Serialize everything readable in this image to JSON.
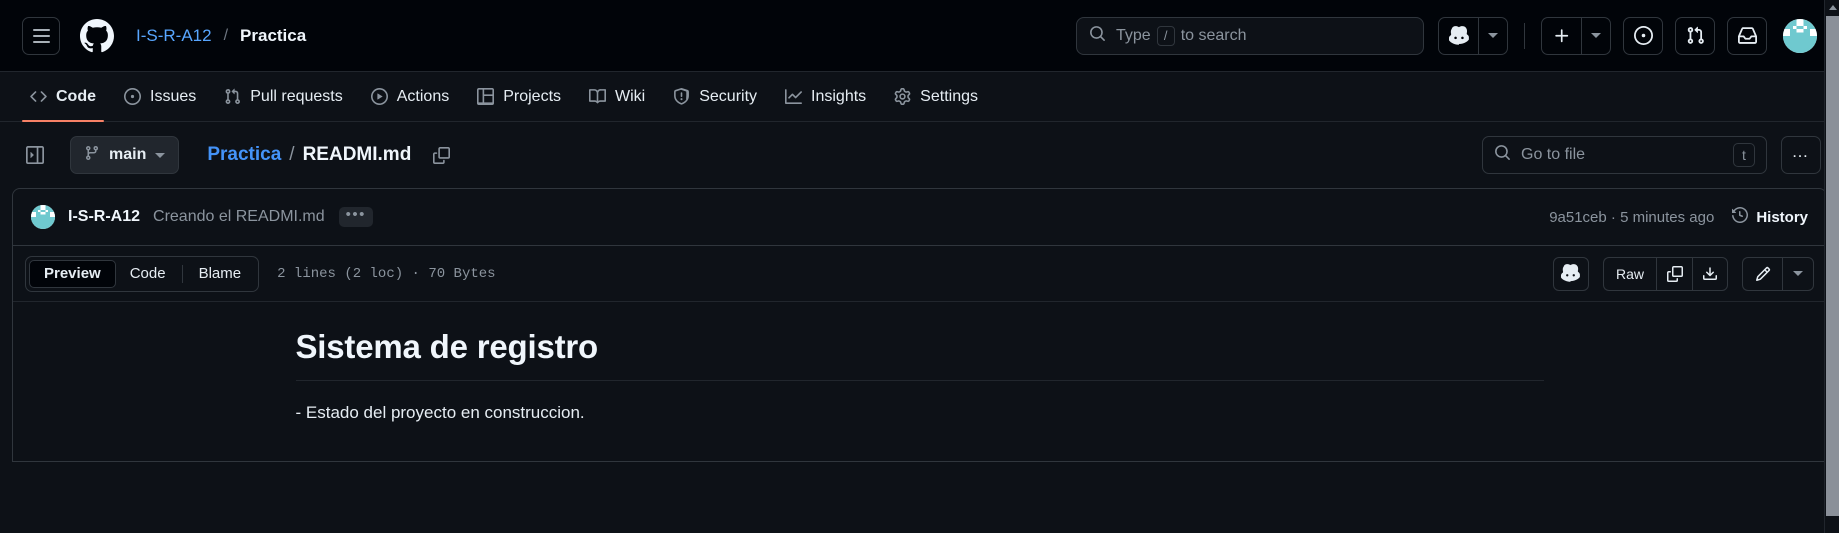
{
  "header": {
    "menu_icon": "hamburger-menu-icon",
    "logo_icon": "github-mark-icon",
    "owner": "I-S-R-A12",
    "separator": "/",
    "repo": "Practica",
    "search": {
      "icon": "search-icon",
      "placeholder_prefix": "Type",
      "key_hint": "/",
      "placeholder_suffix": "to search"
    },
    "actions": [
      {
        "name": "copilot-button",
        "icon": "copilot-icon"
      },
      {
        "name": "copilot-dropdown-button",
        "icon": "chevron-down-icon"
      },
      {
        "name": "create-new-button",
        "icon": "plus-icon"
      },
      {
        "name": "create-new-dropdown-button",
        "icon": "chevron-down-icon"
      },
      {
        "name": "issues-button",
        "icon": "issue-opened-icon"
      },
      {
        "name": "pull-requests-button",
        "icon": "git-pull-request-icon"
      },
      {
        "name": "notifications-button",
        "icon": "inbox-icon"
      },
      {
        "name": "user-avatar",
        "icon": "avatar-icon"
      }
    ]
  },
  "repo_nav": {
    "active": "Code",
    "accent_color": "#f78166",
    "items": [
      {
        "label": "Code",
        "icon": "code-icon"
      },
      {
        "label": "Issues",
        "icon": "issue-opened-icon"
      },
      {
        "label": "Pull requests",
        "icon": "git-pull-request-icon"
      },
      {
        "label": "Actions",
        "icon": "play-icon"
      },
      {
        "label": "Projects",
        "icon": "table-icon"
      },
      {
        "label": "Wiki",
        "icon": "book-icon"
      },
      {
        "label": "Security",
        "icon": "shield-icon"
      },
      {
        "label": "Insights",
        "icon": "graph-icon"
      },
      {
        "label": "Settings",
        "icon": "gear-icon"
      }
    ]
  },
  "file_bar": {
    "sidebar_toggle_icon": "sidebar-expand-icon",
    "branch": "main",
    "branch_icon": "git-branch-icon",
    "path_dir": "Practica",
    "path_sep": "/",
    "path_file": "READMI.md",
    "copy_path_icon": "copy-icon",
    "go_to_file": {
      "icon": "search-icon",
      "placeholder": "Go to file",
      "shortcut_key": "t"
    },
    "more_options": "…",
    "more_options_name": "kebab-menu-button"
  },
  "commit": {
    "avatar_icon": "avatar-icon",
    "author": "I-S-R-A12",
    "message": "Creando el READMI.md",
    "expand_label": "•••",
    "sha_and_time": "9a51ceb · 5 minutes ago",
    "history_label": "History",
    "history_icon": "history-clock-icon"
  },
  "file_toolbar": {
    "tabs": [
      {
        "label": "Preview",
        "active": true
      },
      {
        "label": "Code",
        "active": false
      },
      {
        "label": "Blame",
        "active": false
      }
    ],
    "meta": "2 lines (2 loc) · 70 Bytes",
    "copilot_icon": "copilot-icon",
    "raw_label": "Raw",
    "copy_icon": "copy-icon",
    "download_icon": "download-icon",
    "edit_icon": "pencil-icon",
    "edit_dropdown_icon": "chevron-down-icon"
  },
  "markdown": {
    "heading": "Sistema de registro",
    "paragraph": "- Estado del proyecto en construccion."
  },
  "scrollbar": {
    "up_arrow_icon": "triangle-up-icon",
    "thumb_name": "scrollbar-thumb"
  },
  "colors": {
    "background": "#0d1117",
    "header_background": "#010409",
    "border": "#30363d",
    "link": "#58a6ff",
    "muted": "#8b949e",
    "accent_underline": "#f78166",
    "avatar_teal": "#6fc9cf"
  }
}
